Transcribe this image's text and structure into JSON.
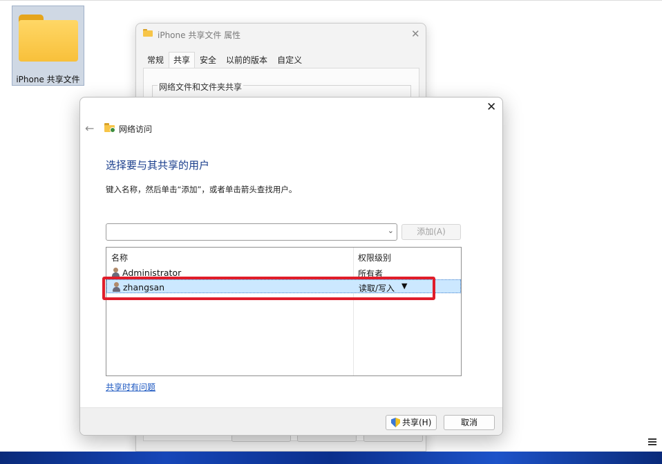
{
  "desktop": {
    "folder_label": "iPhone 共享文件"
  },
  "properties_window": {
    "title": "iPhone 共享文件 属性",
    "tabs": [
      "常规",
      "共享",
      "安全",
      "以前的版本",
      "自定义"
    ],
    "group_label": "网络文件和文件夹共享"
  },
  "dialog": {
    "header_title": "网络访问",
    "heading": "选择要与其共享的用户",
    "instruction": "键入名称，然后单击“添加”，或者单击箭头查找用户。",
    "user_input": {
      "value": "",
      "placeholder": ""
    },
    "add_button": "添加(A)",
    "columns": {
      "name": "名称",
      "permission": "权限级别"
    },
    "users": [
      {
        "name": "Administrator",
        "permission": "所有者"
      },
      {
        "name": "zhangsan",
        "permission": "读取/写入",
        "selected": true
      }
    ],
    "help_link": "共享时有问题",
    "share_button": "共享(H)",
    "cancel_button": "取消"
  },
  "colors": {
    "heading": "#1a3e8c",
    "link": "#1a56c0",
    "selection": "#cce8ff",
    "highlight_annotation": "#e01d2a"
  },
  "icons": [
    "folder-icon",
    "back-arrow-icon",
    "network-folder-icon",
    "user-icon",
    "dropdown-arrow-icon",
    "shield-icon",
    "close-icon"
  ]
}
